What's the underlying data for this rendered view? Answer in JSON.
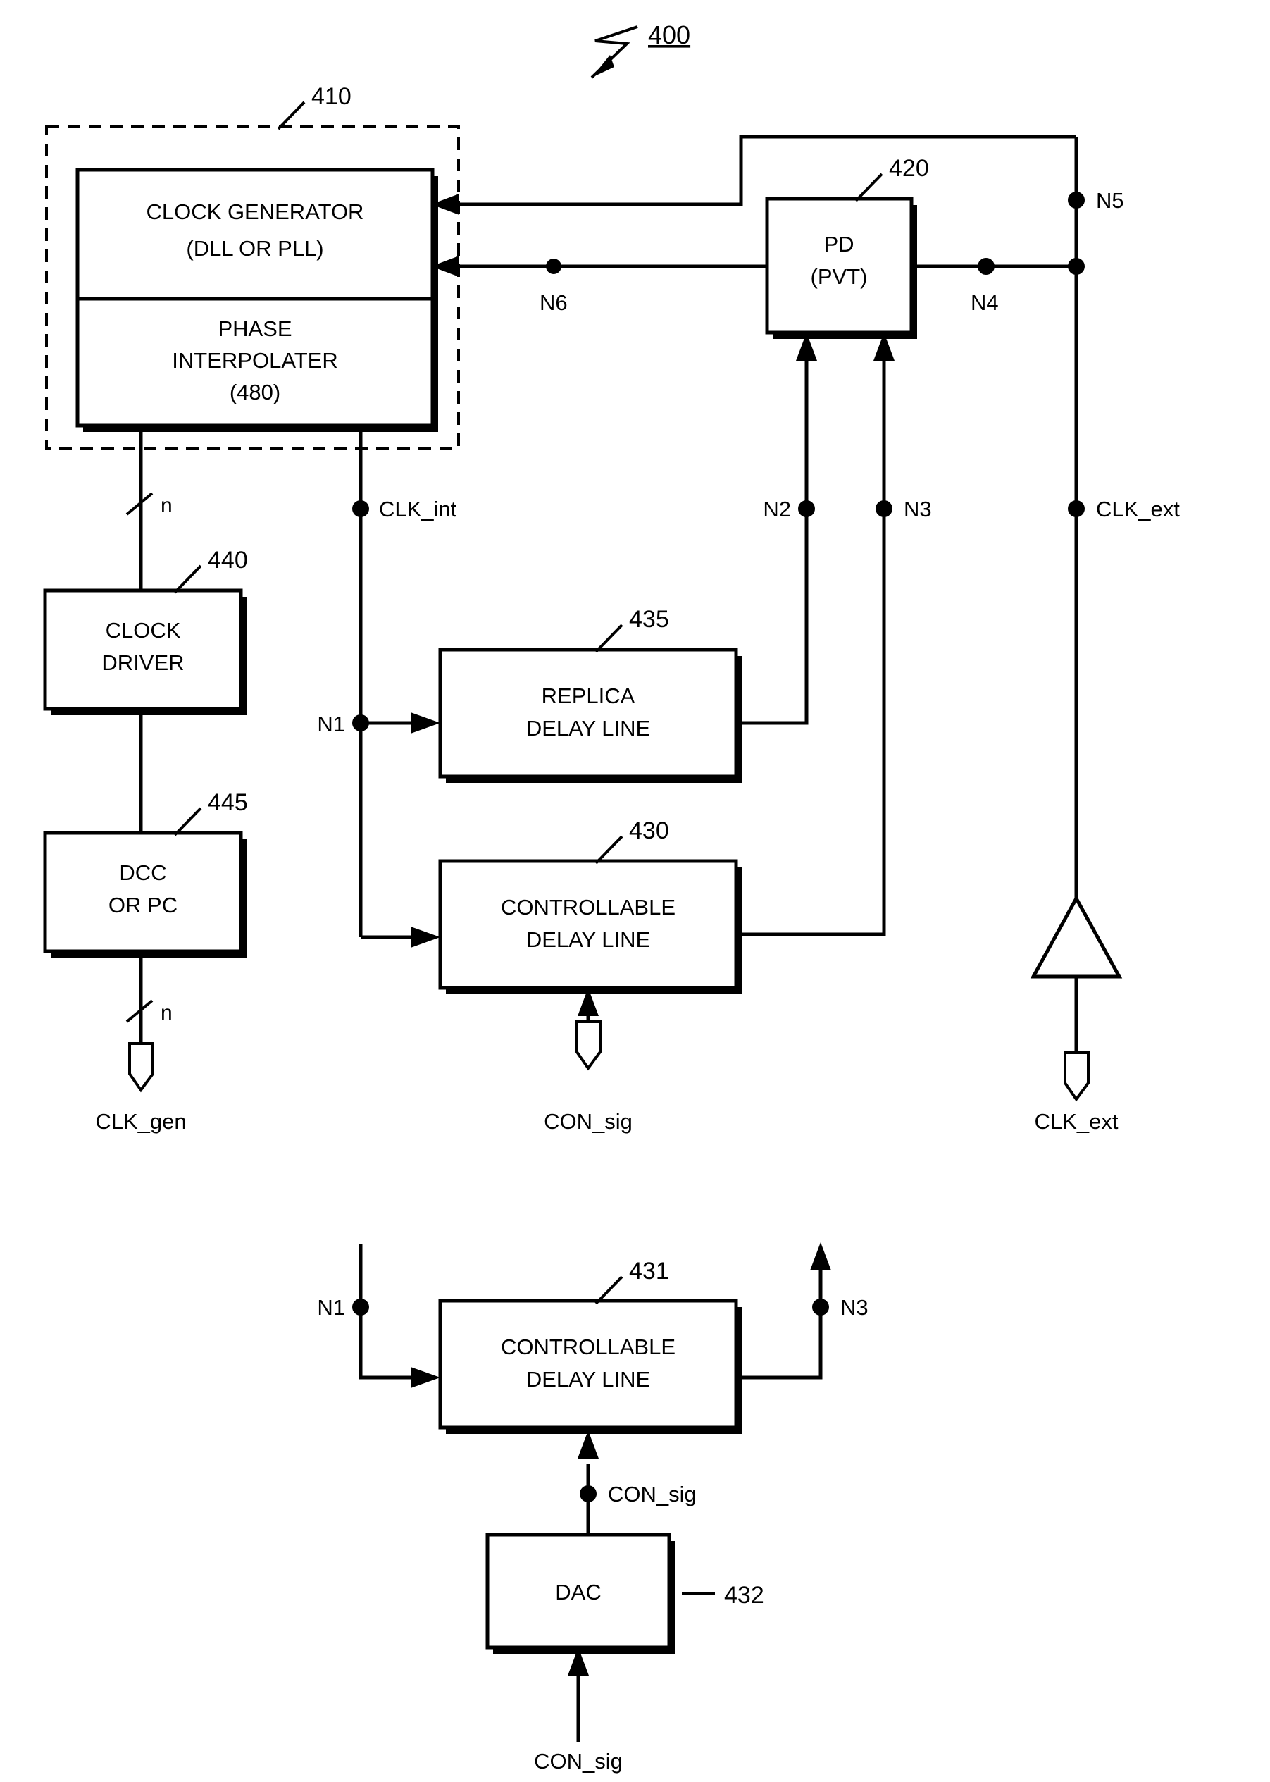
{
  "figure": {
    "number": "400",
    "lead_icon": "squiggle-lead-icon"
  },
  "blocks": {
    "clock_generator": {
      "line1": "CLOCK GENERATOR",
      "line2": "(DLL OR PLL)"
    },
    "phase_interpolater": {
      "line1": "PHASE",
      "line2": "INTERPOLATER",
      "line3": "(480)"
    },
    "pd": {
      "line1": "PD",
      "line2": "(PVT)"
    },
    "clock_driver": {
      "line1": "CLOCK",
      "line2": "DRIVER"
    },
    "dcc_or_pc": {
      "line1": "DCC",
      "line2": "OR PC"
    },
    "replica_delay_line": {
      "line1": "REPLICA",
      "line2": "DELAY LINE"
    },
    "controllable_delay_line": {
      "line1": "CONTROLLABLE",
      "line2": "DELAY LINE"
    },
    "controllable_delay_line_2": {
      "line1": "CONTROLLABLE",
      "line2": "DELAY LINE"
    },
    "dac": {
      "label": "DAC"
    }
  },
  "reference_numerals": {
    "dashed_group": "410",
    "pd": "420",
    "controllable_delay_line": "430",
    "replica_delay_line": "435",
    "clock_driver": "440",
    "dcc_or_pc": "445",
    "controllable_delay_line_2": "431",
    "dac": "432"
  },
  "nodes": {
    "n1": "N1",
    "n2": "N2",
    "n3": "N3",
    "n4": "N4",
    "n5": "N5",
    "n6": "N6",
    "n1_lower": "N1",
    "n3_lower": "N3"
  },
  "signals": {
    "clk_int": "CLK_int",
    "clk_ext_node": "CLK_ext",
    "clk_ext_port": "CLK_ext",
    "clk_gen_port": "CLK_gen",
    "con_sig_port": "CON_sig",
    "con_sig_lower_node": "CON_sig",
    "con_sig_lower_port": "CON_sig",
    "bus_width_top": "n",
    "bus_width_bottom": "n"
  },
  "colors": {
    "ink": "#000000",
    "paper": "#ffffff"
  }
}
